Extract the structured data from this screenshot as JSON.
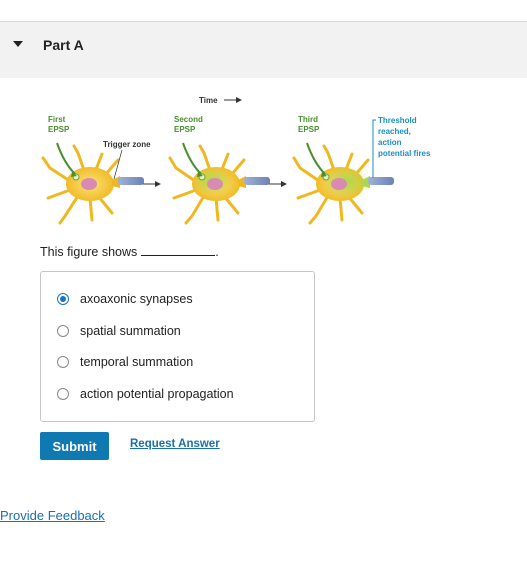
{
  "part": {
    "title": "Part A"
  },
  "figure": {
    "time_label": "Time",
    "first_label_line1": "First",
    "first_label_line2": "EPSP",
    "second_label_line1": "Second",
    "second_label_line2": "EPSP",
    "third_label_line1": "Third",
    "third_label_line2": "EPSP",
    "trigger_zone": "Trigger zone",
    "threshold_line1": "Threshold",
    "threshold_line2": "reached,",
    "threshold_line3": "action",
    "threshold_line4": "potential fires",
    "colors": {
      "epsp_label": "#4a8f2e",
      "threshold": "#1a8fc4",
      "neuron": "#f2c02a"
    }
  },
  "question": {
    "text": "This figure shows"
  },
  "choices": [
    {
      "label": "axoaxonic synapses",
      "selected": true
    },
    {
      "label": "spatial summation",
      "selected": false
    },
    {
      "label": "temporal summation",
      "selected": false
    },
    {
      "label": "action potential propagation",
      "selected": false
    }
  ],
  "actions": {
    "submit_label": "Submit",
    "request_label": "Request Answer"
  },
  "footer": {
    "feedback_label": "Provide Feedback"
  }
}
